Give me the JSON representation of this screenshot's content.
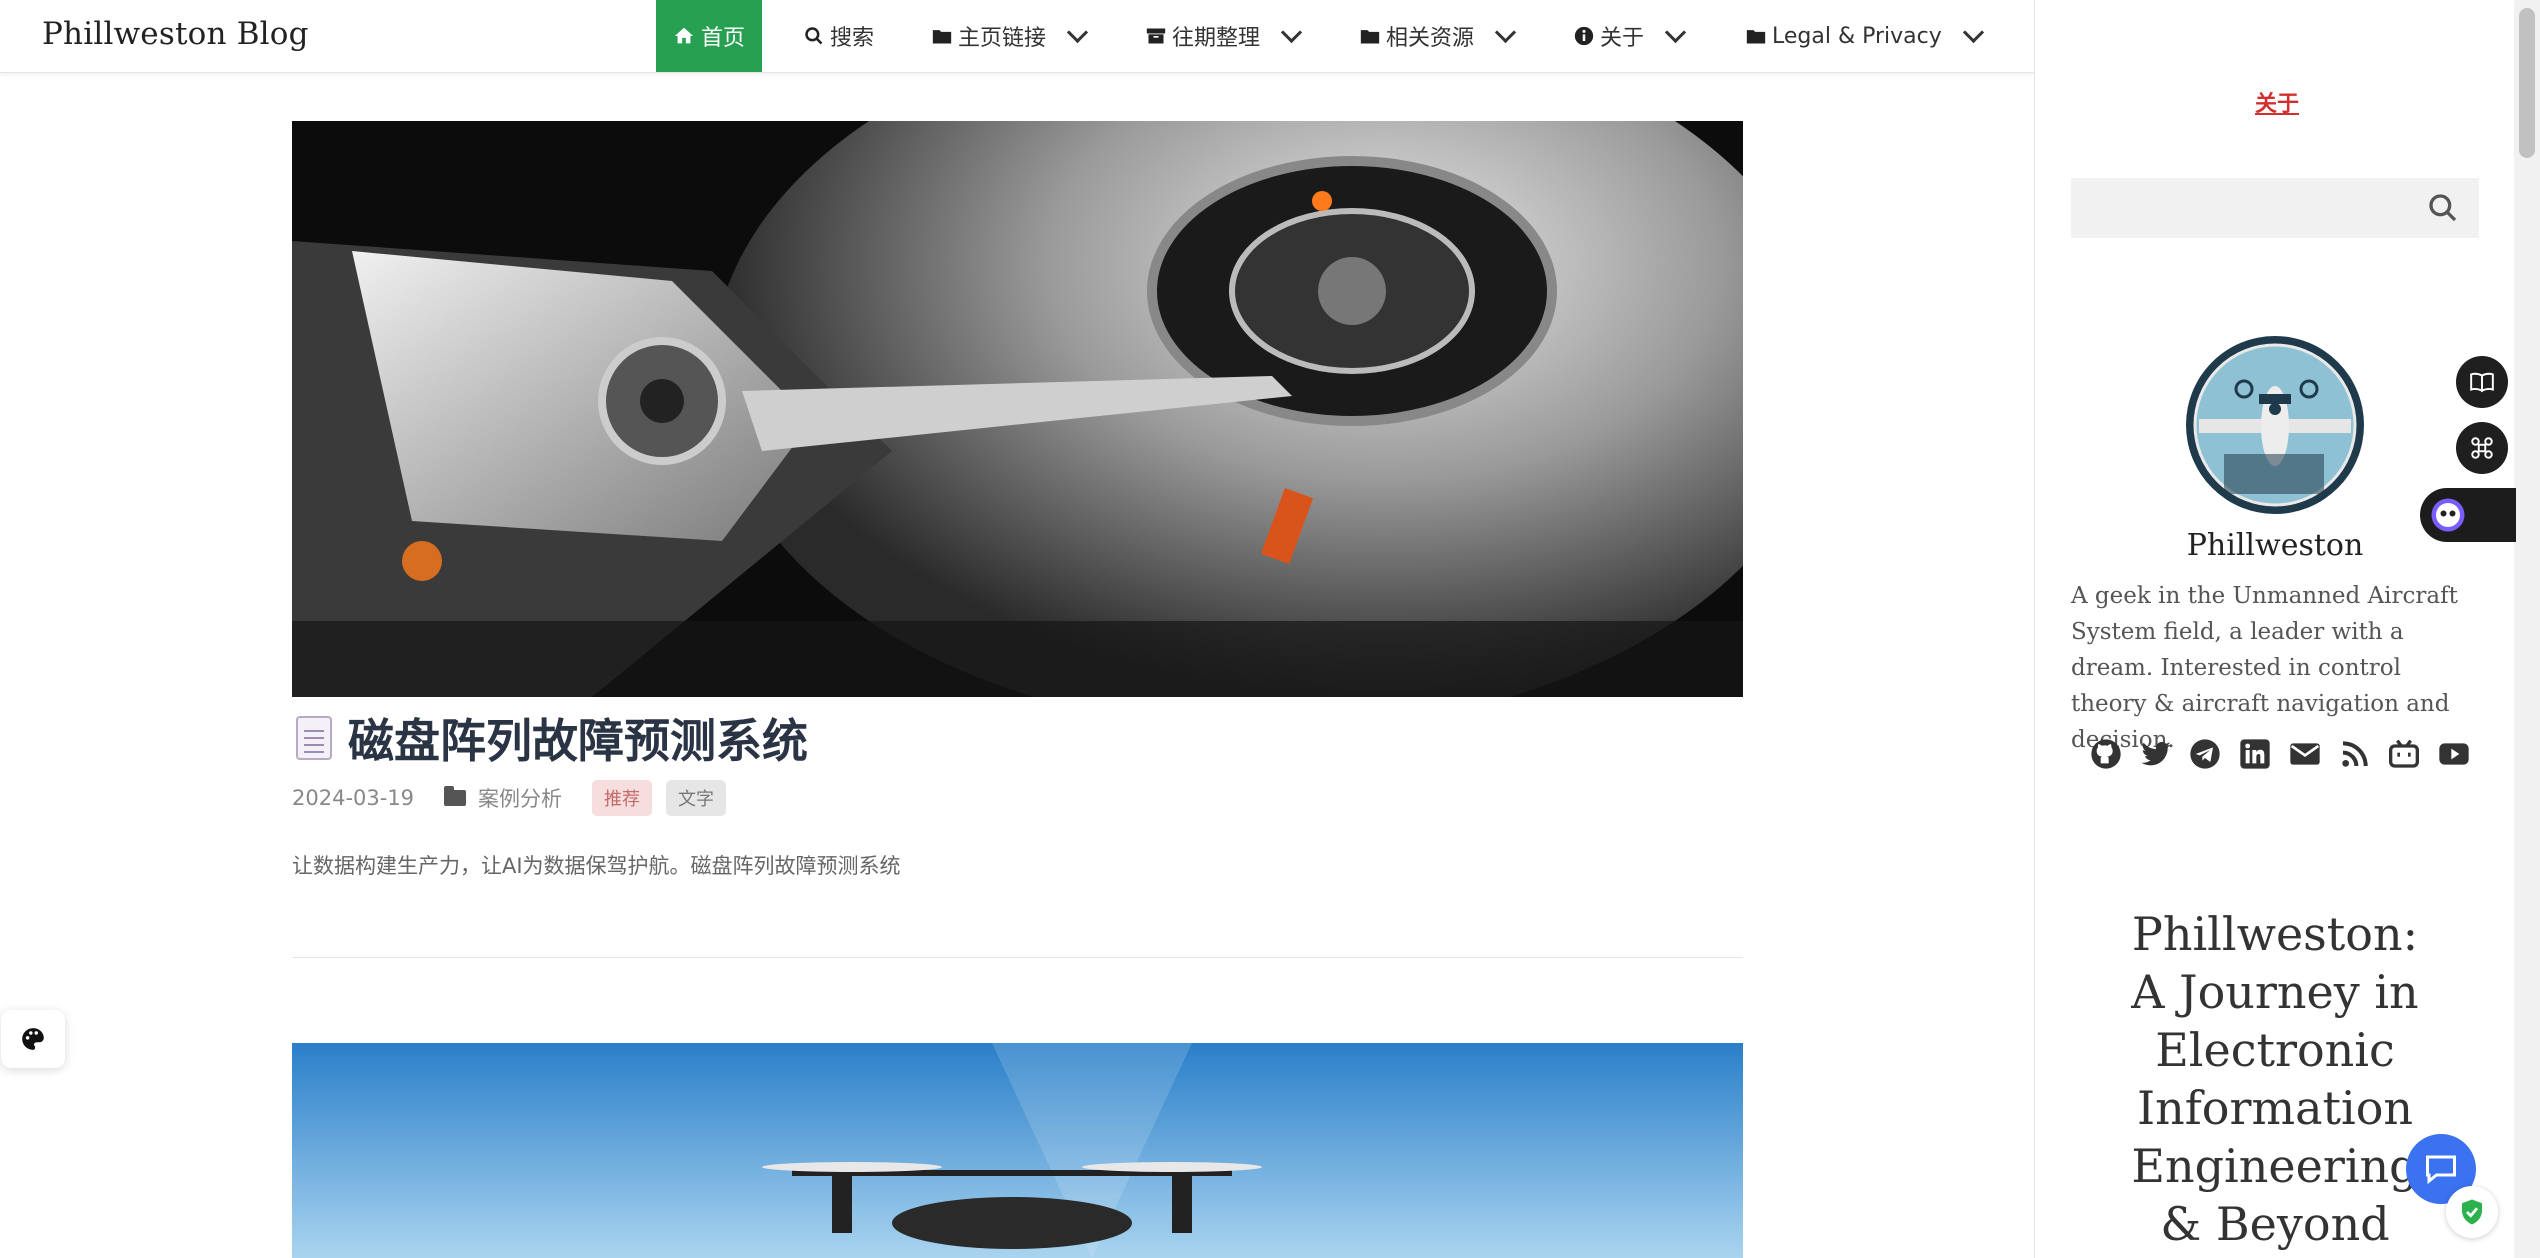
{
  "navbar": {
    "brand": "Phillweston Blog",
    "items": [
      {
        "label": "首页",
        "icon": "home-icon",
        "active": true
      },
      {
        "label": "搜索",
        "icon": "search-icon"
      },
      {
        "label": "主页链接",
        "icon": "folder-icon",
        "dropdown": true
      },
      {
        "label": "往期整理",
        "icon": "archive-icon",
        "dropdown": true
      },
      {
        "label": "相关资源",
        "icon": "folder-icon",
        "dropdown": true
      },
      {
        "label": "关于",
        "icon": "info-icon",
        "dropdown": true
      },
      {
        "label": "Legal & Privacy",
        "icon": "folder-icon",
        "dropdown": true
      }
    ]
  },
  "post": {
    "title": "磁盘阵列故障预测系统",
    "title_icon": "memo-icon",
    "date": "2024-03-19",
    "category": "案例分析",
    "tags": [
      "推荐",
      "文字"
    ],
    "excerpt": "让数据构建生产力，让AI为数据保驾护航。磁盘阵列故障预测系统"
  },
  "sidebar": {
    "about_link": "关于",
    "search": {
      "value": "",
      "placeholder": ""
    },
    "profile": {
      "name": "Phillweston",
      "bio": "A geek in the Unmanned Aircraft System field, a leader with a dream. Interested in control theory & aircraft navigation and decision."
    },
    "socials": [
      "github-icon",
      "twitter-icon",
      "telegram-icon",
      "linkedin-icon",
      "email-icon",
      "rss-icon",
      "bilibili-icon",
      "youtube-icon"
    ],
    "heading": "Phillweston: A Journey in Electronic Information Engineering & Beyond"
  },
  "colors": {
    "accent": "#27a052",
    "about_red": "#d32f2f",
    "title": "#2b3445",
    "chat_blue": "#3b72f0"
  }
}
